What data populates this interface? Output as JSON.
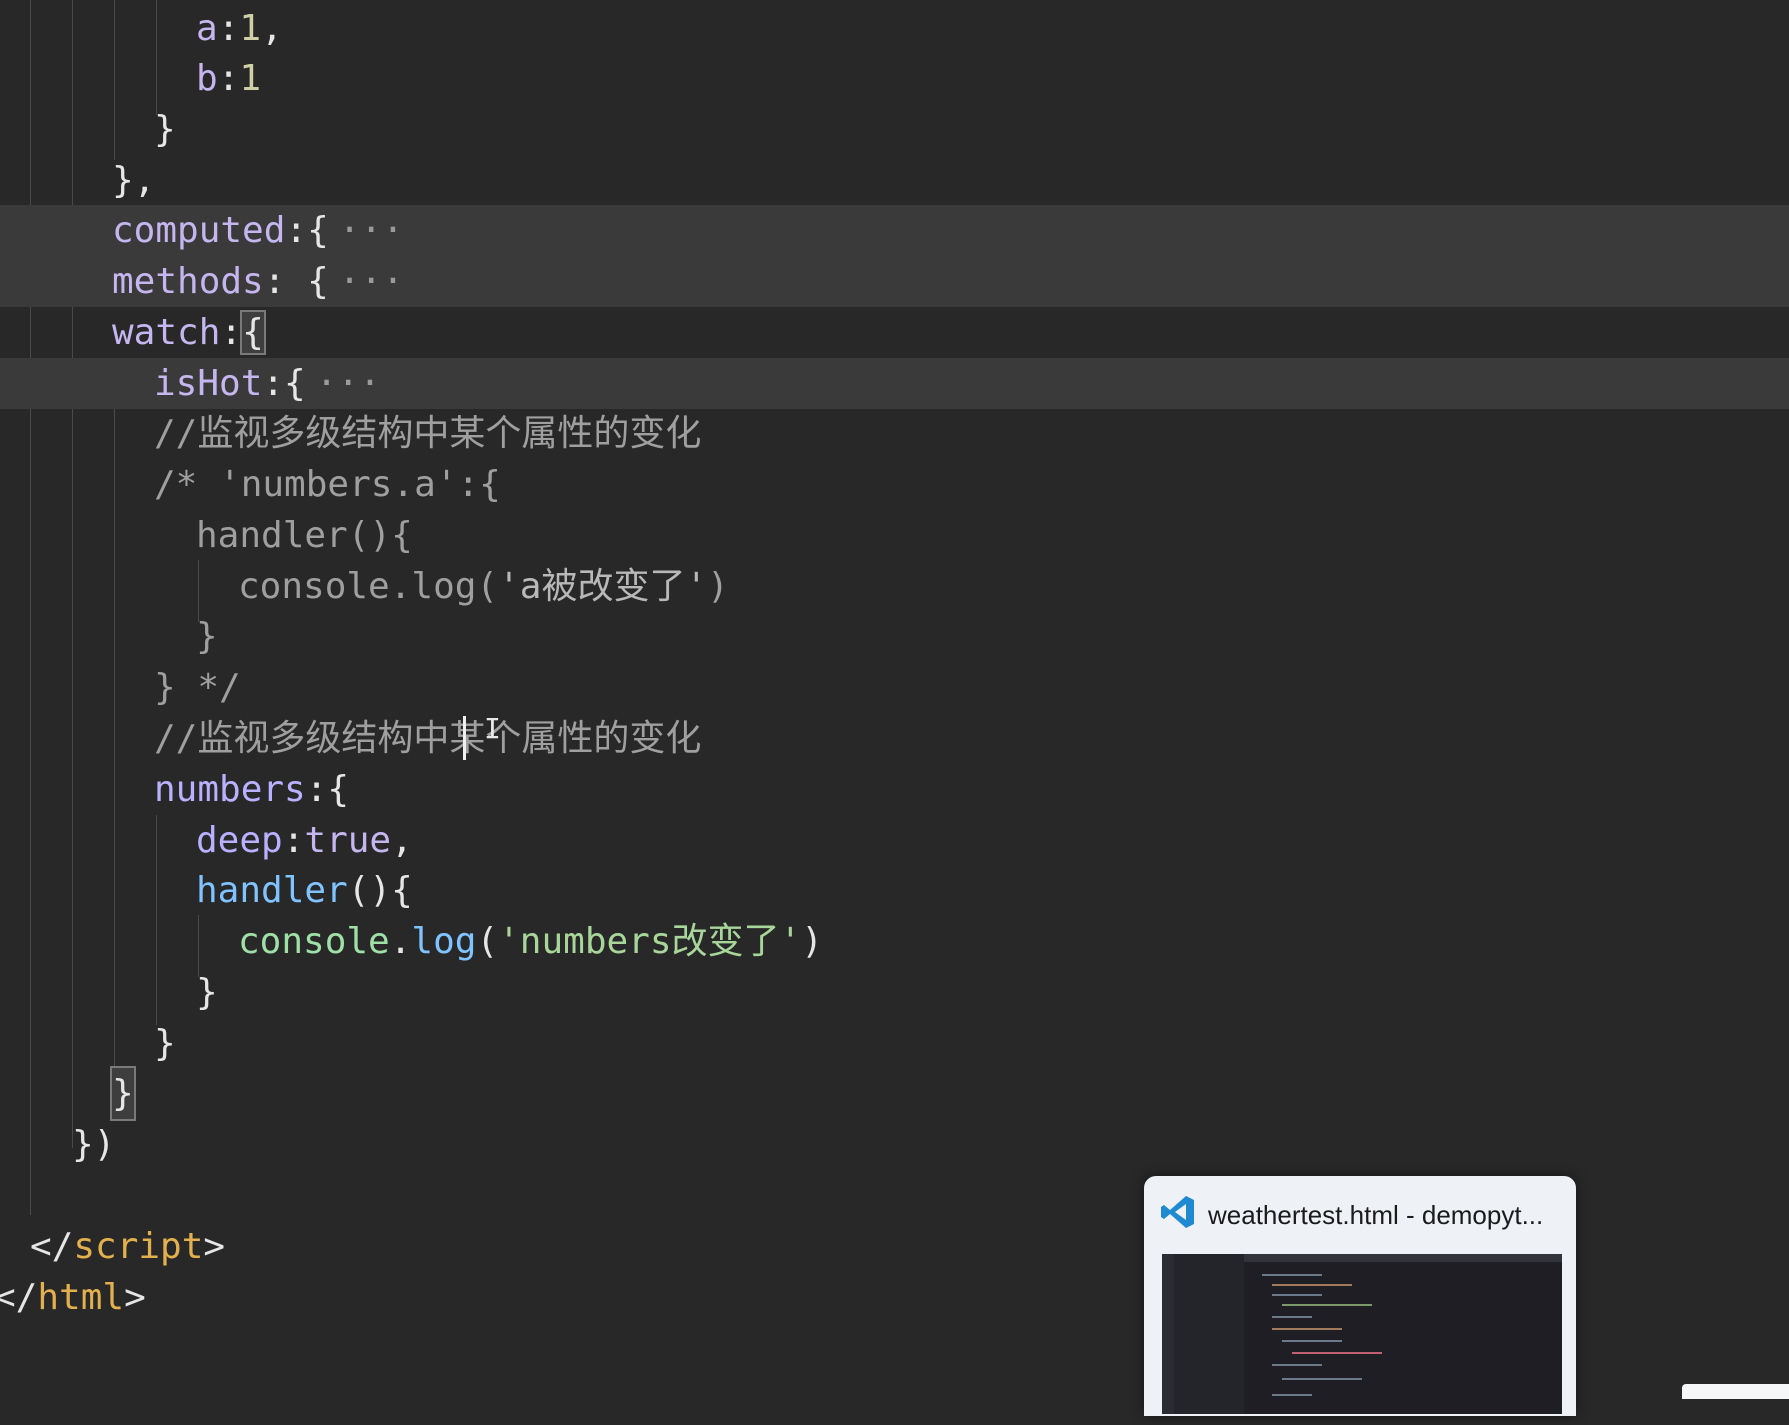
{
  "code_lines": [
    {
      "key": "a",
      "val": "1",
      "trail": ","
    },
    {
      "key": "b",
      "val": "1",
      "trail": ""
    },
    {
      "text": "}"
    },
    {
      "text": "},"
    },
    {
      "key": "computed",
      "rest": ":{",
      "fold": "···"
    },
    {
      "key": "methods",
      "rest": ": {",
      "fold": "···"
    },
    {
      "key": "watch",
      "rest": ":",
      "brace": "{"
    },
    {
      "key": "isHot",
      "rest": ":{",
      "fold": "···"
    },
    {
      "comment": "//监视多级结构中某个属性的变化"
    },
    {
      "comment": "/* 'numbers.a':{"
    },
    {
      "comment": "handler(){"
    },
    {
      "comment_pre": "console.log(",
      "comment_str": "'a被改变了'",
      "comment_post": ")"
    },
    {
      "comment": "}"
    },
    {
      "comment": "} */"
    },
    {
      "comment": "//监视多级结构中某个属性的变化"
    },
    {
      "key": "numbers",
      "rest": ":{"
    },
    {
      "key": "deep",
      "rest": ":",
      "kw": "true",
      "trail": ","
    },
    {
      "fn": "handler",
      "rest": "(){"
    },
    {
      "obj": "console",
      "dot": ".",
      "fn": "log",
      "open": "(",
      "str": "'numbers改变了'",
      "close": ")"
    },
    {
      "text": "}"
    },
    {
      "text": "}"
    },
    {
      "brace": "}"
    },
    {
      "text": "})"
    },
    {
      "text": ""
    },
    {
      "tag_open": "</",
      "tag": "script",
      "tag_close": ">"
    },
    {
      "tag_open": "</",
      "tag": "html",
      "tag_close": ">"
    }
  ],
  "taskbar_preview": {
    "icon": "vscode-icon",
    "title": "weathertest.html - demopyt..."
  }
}
